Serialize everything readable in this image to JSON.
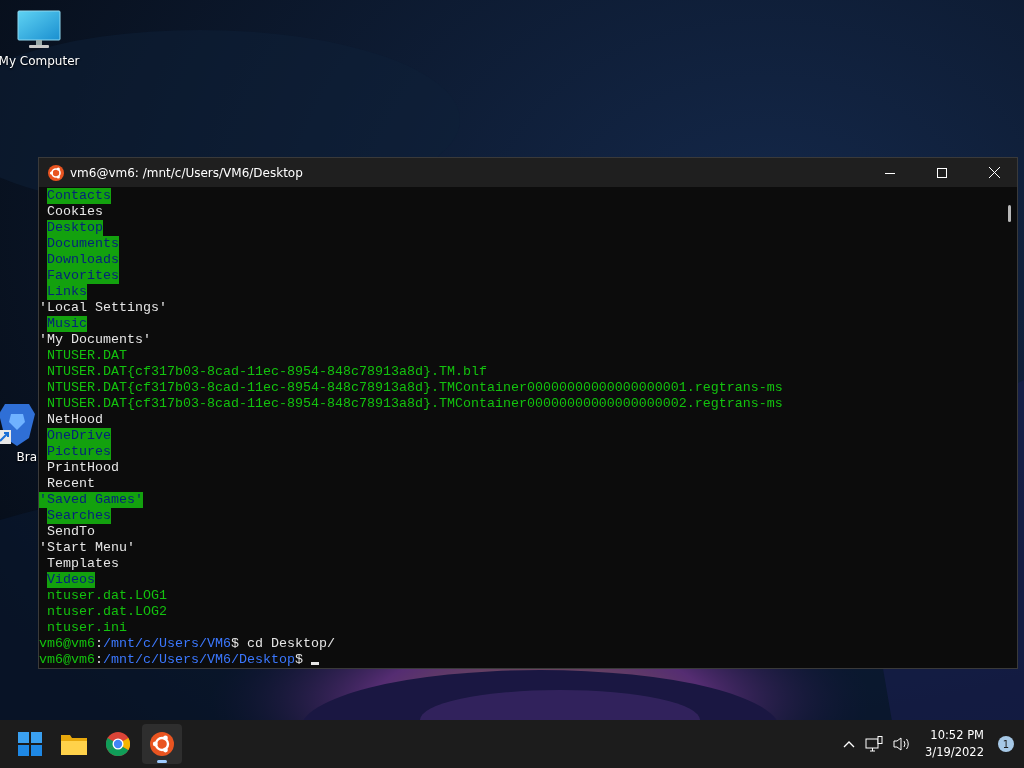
{
  "desktop_icons": [
    {
      "label": "My Computer",
      "kind": "computer"
    },
    {
      "label": "Bra",
      "kind": "lion"
    }
  ],
  "terminal": {
    "title": "vm6@vm6: /mnt/c/Users/VM6/Desktop",
    "lines": [
      {
        "text": "Contacts",
        "kind": "dir",
        "quoted": false
      },
      {
        "text": "Cookies",
        "kind": "file",
        "quoted": false
      },
      {
        "text": "Desktop",
        "kind": "dir",
        "quoted": false
      },
      {
        "text": "Documents",
        "kind": "dir",
        "quoted": false
      },
      {
        "text": "Downloads",
        "kind": "dir",
        "quoted": false
      },
      {
        "text": "Favorites",
        "kind": "dir",
        "quoted": false
      },
      {
        "text": "Links",
        "kind": "dir",
        "quoted": false
      },
      {
        "text": "'Local Settings'",
        "kind": "file",
        "quoted": true
      },
      {
        "text": "Music",
        "kind": "dir",
        "quoted": false
      },
      {
        "text": "'My Documents'",
        "kind": "file",
        "quoted": true
      },
      {
        "text": "NTUSER.DAT",
        "kind": "data",
        "quoted": false
      },
      {
        "text": "NTUSER.DAT{cf317b03-8cad-11ec-8954-848c78913a8d}.TM.blf",
        "kind": "data",
        "quoted": false
      },
      {
        "text": "NTUSER.DAT{cf317b03-8cad-11ec-8954-848c78913a8d}.TMContainer00000000000000000001.regtrans-ms",
        "kind": "data",
        "quoted": false
      },
      {
        "text": "NTUSER.DAT{cf317b03-8cad-11ec-8954-848c78913a8d}.TMContainer00000000000000000002.regtrans-ms",
        "kind": "data",
        "quoted": false
      },
      {
        "text": "NetHood",
        "kind": "file",
        "quoted": false
      },
      {
        "text": "OneDrive",
        "kind": "dir",
        "quoted": false
      },
      {
        "text": "Pictures",
        "kind": "dir",
        "quoted": false
      },
      {
        "text": "PrintHood",
        "kind": "file",
        "quoted": false
      },
      {
        "text": "Recent",
        "kind": "file",
        "quoted": false
      },
      {
        "text": "'Saved Games'",
        "kind": "dir",
        "quoted": true
      },
      {
        "text": "Searches",
        "kind": "dir",
        "quoted": false
      },
      {
        "text": "SendTo",
        "kind": "file",
        "quoted": false
      },
      {
        "text": "'Start Menu'",
        "kind": "file",
        "quoted": true
      },
      {
        "text": "Templates",
        "kind": "file",
        "quoted": false
      },
      {
        "text": "Videos",
        "kind": "dir",
        "quoted": false
      },
      {
        "text": "ntuser.dat.LOG1",
        "kind": "data",
        "quoted": false
      },
      {
        "text": "ntuser.dat.LOG2",
        "kind": "data",
        "quoted": false
      },
      {
        "text": "ntuser.ini",
        "kind": "data",
        "quoted": false
      }
    ],
    "prompts": [
      {
        "user": "vm6@vm6",
        "sep": ":",
        "path": "/mnt/c/Users/VM6",
        "sign": "$",
        "command": "cd Desktop/",
        "cursor": false
      },
      {
        "user": "vm6@vm6",
        "sep": ":",
        "path": "/mnt/c/Users/VM6/Desktop",
        "sign": "$",
        "cursor": true
      }
    ]
  },
  "taskbar": {
    "apps": [
      {
        "kind": "start",
        "selected": false
      },
      {
        "kind": "folder",
        "selected": false
      },
      {
        "kind": "chrome",
        "selected": false
      },
      {
        "kind": "ubuntu",
        "selected": true
      }
    ],
    "time": "10:52 PM",
    "date": "3/19/2022",
    "notifications": "1"
  }
}
